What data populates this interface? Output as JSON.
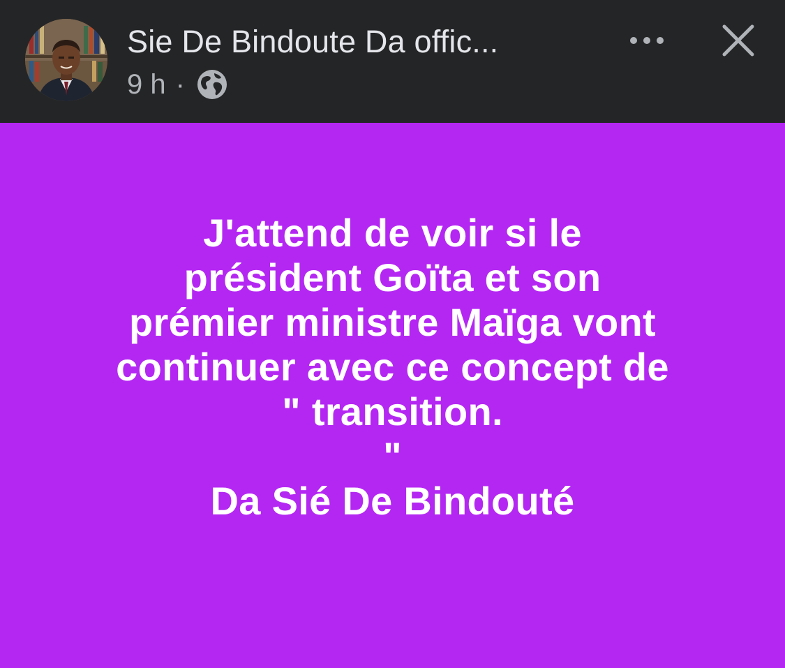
{
  "header": {
    "author_name": "Sie De Bindoute Da offic...",
    "time": "9 h",
    "separator": "·",
    "audience_icon": "globe-icon",
    "more_icon": "more-horizontal-icon",
    "close_icon": "close-icon"
  },
  "post": {
    "background_color": "#b427f2",
    "text_color": "#ffffff",
    "lines": [
      "J'attend de voir si le",
      "président Goïta et son",
      "prémier ministre Maïga vont",
      "continuer avec ce concept de",
      "\" transition.",
      "\"",
      "Da Sié De Bindouté"
    ]
  }
}
